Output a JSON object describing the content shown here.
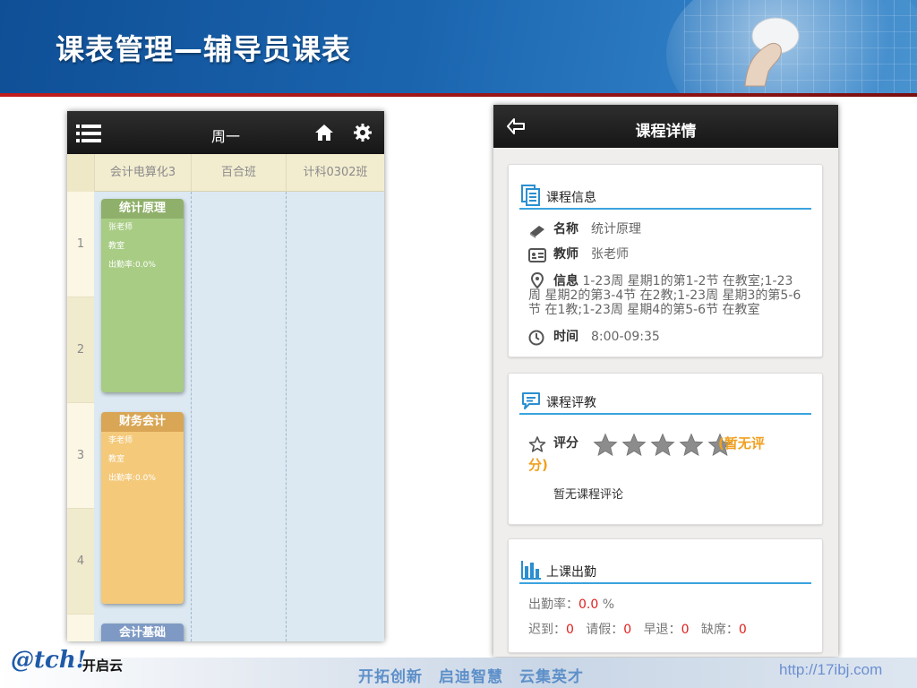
{
  "slide": {
    "title": "课表管理—辅导员课表"
  },
  "timetable": {
    "day": "周一",
    "icons": {
      "menu": "list-icon",
      "home": "home-icon",
      "settings": "gear-icon"
    },
    "columns": [
      "会计电算化3",
      "百合班",
      "计科0302班"
    ],
    "periods": [
      "1",
      "2",
      "3",
      "4"
    ],
    "courses": [
      {
        "name": "统计原理",
        "teacher": "张老师",
        "room": "教室",
        "attendance": "出勤率:0.0%",
        "color": "#a8cc84"
      },
      {
        "name": "财务会计",
        "teacher": "李老师",
        "room": "教室",
        "attendance": "出勤率:0.0%",
        "color": "#f4c97a"
      },
      {
        "name": "会计基础",
        "color": "#9bb4d6"
      }
    ]
  },
  "detail": {
    "title": "课程详情",
    "back_icon": "back-arrow-icon",
    "course_info": {
      "heading": "课程信息",
      "name_label": "名称",
      "name_value": "统计原理",
      "teacher_label": "教师",
      "teacher_value": "张老师",
      "info_label": "信息",
      "info_line1": "1-23周 星期1的第1-2节 在教室;1-23",
      "info_line2": "周 星期2的第3-4节 在2教;1-23周 星期3的第5-6",
      "info_line3": "节 在1教;1-23周 星期4的第5-6节 在教室",
      "time_label": "时间",
      "time_value": "8:00-09:35"
    },
    "evaluation": {
      "heading": "课程评教",
      "rating_label": "评分",
      "rating_value": 0,
      "rating_max": 5,
      "no_rating_line1": "(暂无评",
      "no_rating_line2": "分)",
      "no_comments": "暂无课程评论"
    },
    "attendance": {
      "heading": "上课出勤",
      "rate_label": "出勤率：",
      "rate_value": "0.0",
      "rate_unit": " %",
      "late_label": "迟到：",
      "late_value": "0",
      "leave_label": "请假：",
      "leave_value": "0",
      "early_label": "早退：",
      "early_value": "0",
      "absent_label": "缺席：",
      "absent_value": "0"
    }
  },
  "footer": {
    "logo_mark": "@tch!",
    "logo_brand": "开启云",
    "slogan": "开拓创新　启迪智慧　云集英才",
    "url": "http://17ibj.com"
  },
  "colors": {
    "header_blue": "#1a64ae",
    "accent_blue": "#3ba3de",
    "rating_orange": "#f0a020",
    "attendance_red": "#e02020"
  }
}
